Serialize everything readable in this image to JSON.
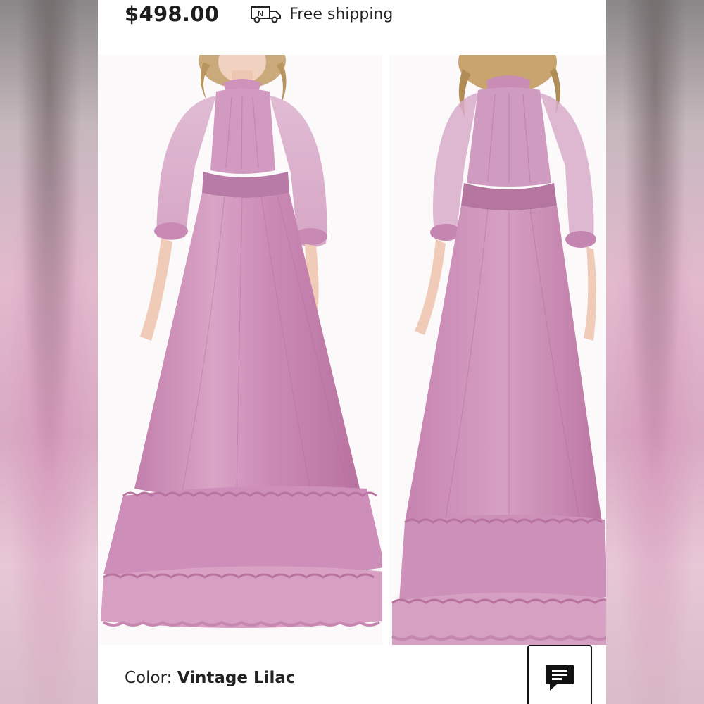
{
  "product": {
    "price": "$498.00",
    "shipping_label": "Free shipping",
    "shipping_badge_letter": "N",
    "color_label": "Color:",
    "color_value": "Vintage Lilac"
  },
  "gallery": {
    "images": [
      {
        "name": "front-view"
      },
      {
        "name": "back-view"
      }
    ]
  },
  "icons": {
    "shipping": "truck-icon",
    "chat": "chat-bubble-icon"
  },
  "colors": {
    "dress": "#c98bb3",
    "dress_light": "#dfb1cf",
    "dress_shadow": "#a8679a",
    "text": "#1d1d1d"
  }
}
